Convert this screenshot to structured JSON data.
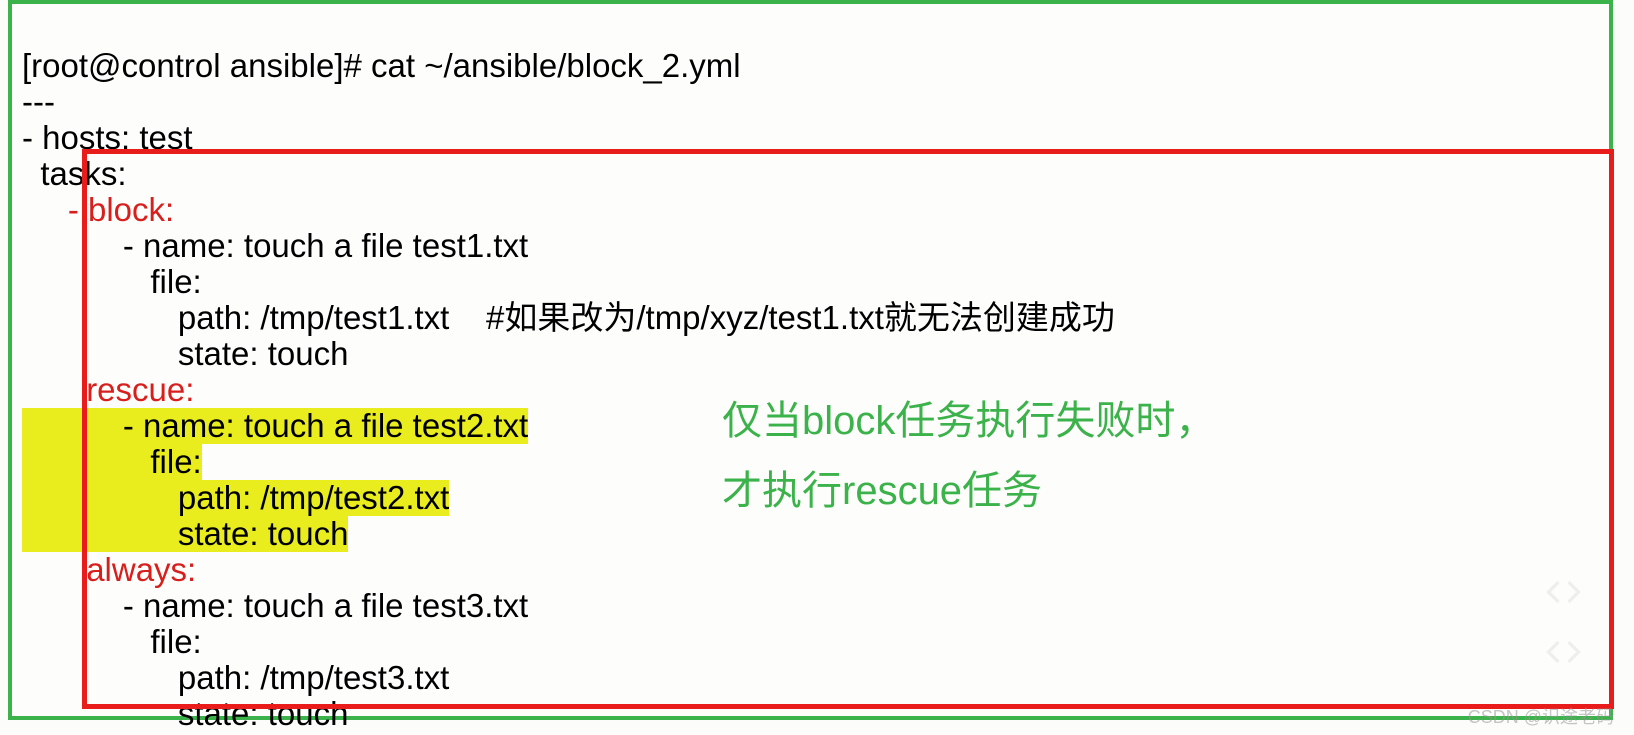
{
  "prompt_line": "[root@control ansible]# cat ~/ansible/block_2.yml",
  "yaml": {
    "doc_start": "---",
    "hosts_line": "- hosts: test",
    "tasks_line": "  tasks:",
    "block_header": "     - block:",
    "block_task": {
      "name": "           - name: touch a file test1.txt",
      "file": "              file:",
      "path": "                 path: /tmp/test1.txt",
      "path_comment": "    #如果改为/tmp/xyz/test1.txt就无法创建成功",
      "state": "                 state: touch"
    },
    "rescue_header": "       rescue:",
    "rescue_task": {
      "name": "           - name: touch a file test2.txt",
      "file": "              file:",
      "path": "                 path: /tmp/test2.txt",
      "state": "                 state: touch"
    },
    "always_header": "       always:",
    "always_task": {
      "name": "           - name: touch a file test3.txt",
      "file": "              file:",
      "path": "                 path: /tmp/test3.txt",
      "state": "                 state: touch"
    }
  },
  "annotation": {
    "line1": "仅当block任务执行失败时，",
    "line2": "才执行rescue任务"
  },
  "watermark": "CSDN @识途老码"
}
